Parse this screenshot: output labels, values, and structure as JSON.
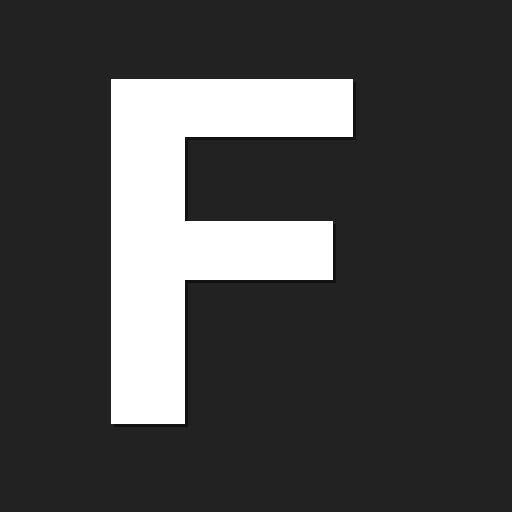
{
  "icon": {
    "name": "letter-f-icon",
    "letter": "F",
    "colors": {
      "background": "#222222",
      "glyph": "#ffffff",
      "glyph_shadow": "#000000"
    }
  }
}
